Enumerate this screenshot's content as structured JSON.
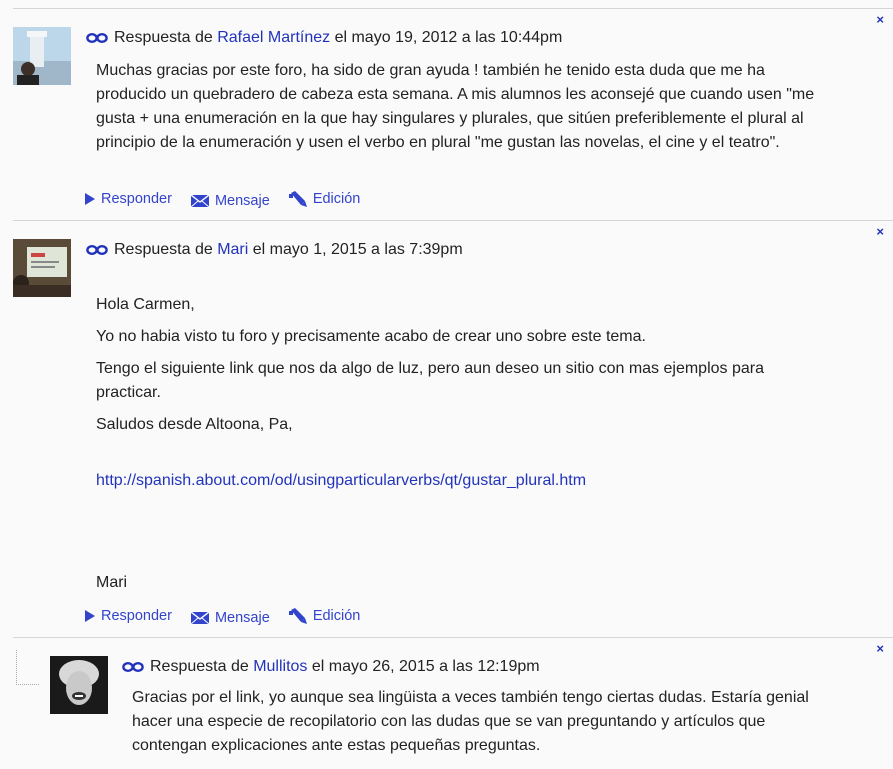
{
  "icons": {
    "link": "link-chain-icon",
    "reply": "triangle-right-icon",
    "message": "envelope-icon",
    "edit": "pencil-icon",
    "delete": "close-x-icon"
  },
  "colors": {
    "link": "#2233bb",
    "text": "#222222",
    "divider": "#d6d6d6",
    "background": "#fafafa"
  },
  "posts": [
    {
      "prefix": "Respuesta de",
      "author": "Rafael Martínez",
      "date": "el mayo 19, 2012 a las 10:44pm",
      "body": [
        "Muchas gracias por este foro, ha sido de gran ayuda ! también he tenido esta duda que me ha producido un quebradero de cabeza esta semana. A mis alumnos les aconsejé que cuando usen \"me gusta + una enumeración en la que hay singulares y plurales, que sitúen preferiblemente el plural al principio de la enumeración y usen el verbo en plural \"me gustan las novelas, el cine y el teatro\"."
      ],
      "actions": {
        "reply": "Responder",
        "message": "Mensaje",
        "edit": "Edición"
      },
      "delete": "×"
    },
    {
      "prefix": "Respuesta de",
      "author": "Mari",
      "date": "el mayo 1, 2015 a las 7:39pm",
      "body": [
        "Hola Carmen,",
        "Yo no habia visto tu foro y precisamente acabo de crear uno sobre este tema.",
        "Tengo el siguiente link que nos da algo de luz, pero aun deseo un sitio con mas ejemplos para practicar.",
        "Saludos desde Altoona, Pa,"
      ],
      "url": "http://spanish.about.com/od/usingparticularverbs/qt/gustar_plural.htm",
      "signature": "Mari",
      "actions": {
        "reply": "Responder",
        "message": "Mensaje",
        "edit": "Edición"
      },
      "delete": "×"
    },
    {
      "prefix": "Respuesta de",
      "author": "Mullitos",
      "date": "el mayo 26, 2015 a las 12:19pm",
      "body": [
        "Gracias por el link, yo aunque sea lingüista a veces también tengo ciertas dudas. Estaría genial hacer una especie de recopilatorio con las dudas que se van preguntando y artículos que contengan explicaciones ante estas pequeñas preguntas."
      ],
      "delete": "×"
    }
  ]
}
